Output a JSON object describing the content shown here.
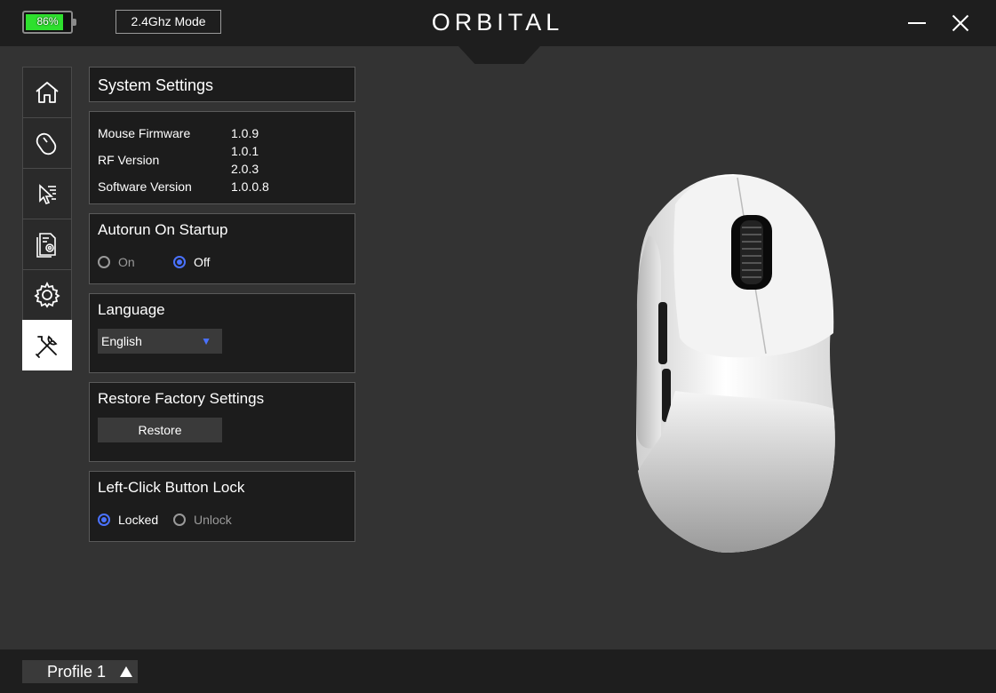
{
  "header": {
    "battery_percent": 86,
    "battery_label": "86%",
    "battery_color": "#2ee02e",
    "mode_label": "2.4Ghz Mode",
    "logo": "ORBITAL"
  },
  "nav": {
    "items": [
      {
        "name": "home",
        "icon": "home-icon"
      },
      {
        "name": "mouse",
        "icon": "mouse-icon"
      },
      {
        "name": "pointer",
        "icon": "pointer-icon"
      },
      {
        "name": "macro",
        "icon": "document-gear-icon"
      },
      {
        "name": "settings",
        "icon": "gear-icon"
      },
      {
        "name": "system",
        "icon": "tools-icon",
        "active": true
      }
    ]
  },
  "system": {
    "title": "System Settings",
    "info": {
      "mouse_firmware_label": "Mouse Firmware",
      "mouse_firmware_value": "1.0.9",
      "rf_version_label": "RF Version",
      "rf_version_value_1": "1.0.1",
      "rf_version_value_2": "2.0.3",
      "software_version_label": "Software Version",
      "software_version_value": "1.0.0.8"
    },
    "autorun": {
      "title": "Autorun On Startup",
      "on_label": "On",
      "off_label": "Off",
      "selected": "Off"
    },
    "language": {
      "title": "Language",
      "selected": "English"
    },
    "restore": {
      "title": "Restore Factory Settings",
      "button_label": "Restore"
    },
    "lock": {
      "title": "Left-Click Button Lock",
      "locked_label": "Locked",
      "unlock_label": "Unlock",
      "selected": "Locked"
    }
  },
  "footer": {
    "profile_label": "Profile 1"
  },
  "colors": {
    "accent": "#4a72ff",
    "background": "#333333",
    "panel": "#1c1c1c"
  }
}
